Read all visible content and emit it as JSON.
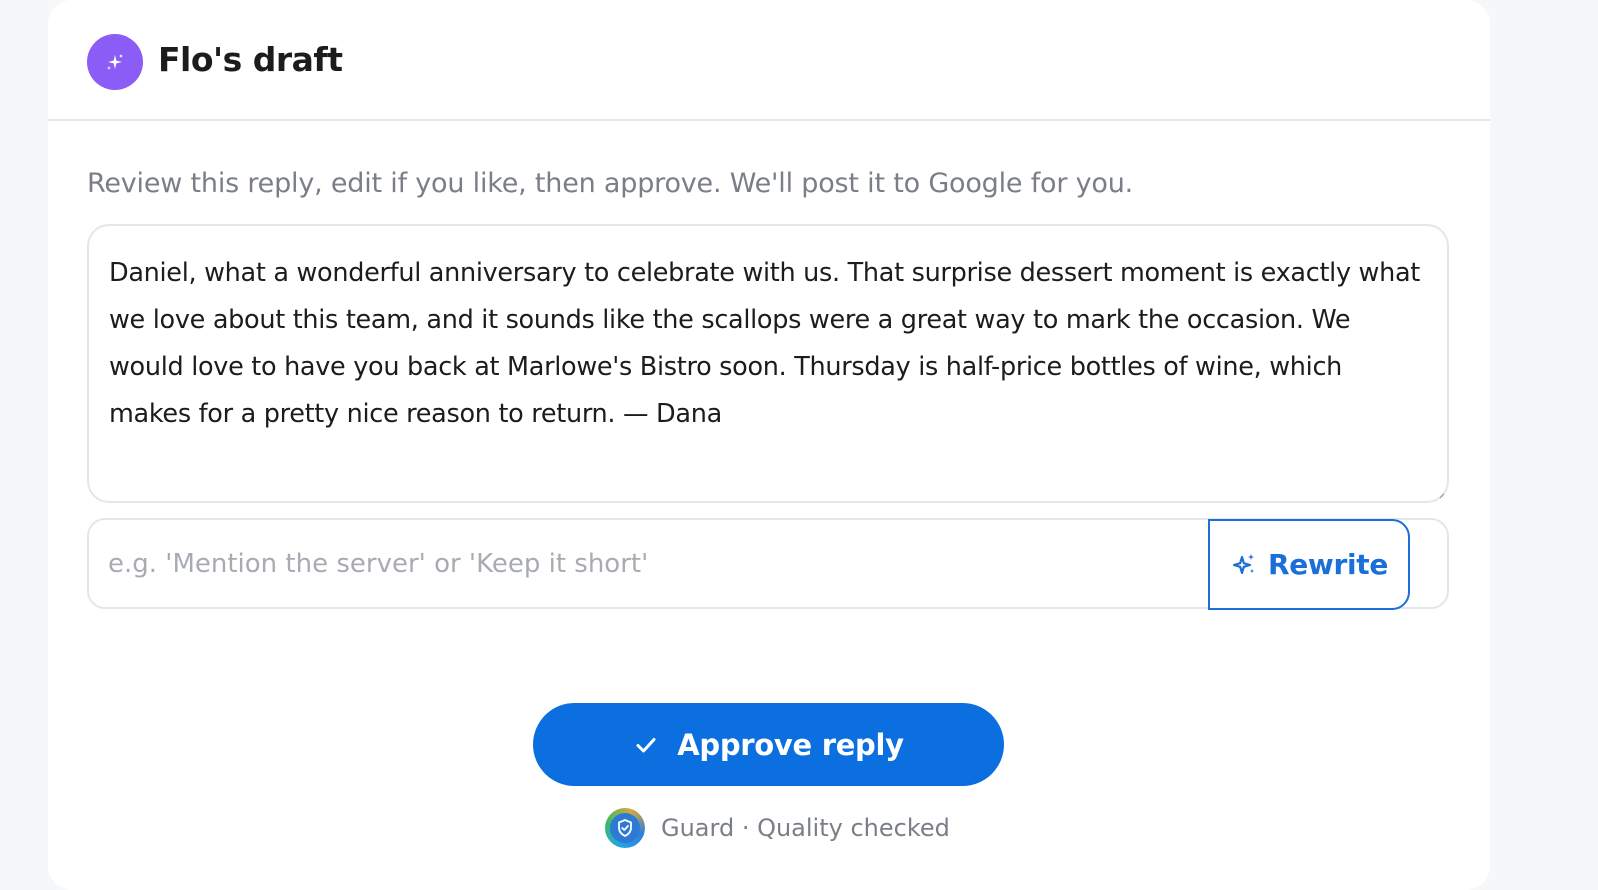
{
  "header": {
    "title": "Flo's draft",
    "avatar_icon": "sparkle-icon",
    "avatar_color": "#8b5cf6"
  },
  "instructions": "Review this reply, edit if you like, then approve. We'll post it to Google for you.",
  "reply": {
    "text": "Daniel, what a wonderful anniversary to celebrate with us. That surprise dessert moment is exactly what we love about this team, and it sounds like the scallops were a great way to mark the occasion. We would love to have you back at Marlowe's Bistro soon. Thursday is half-price bottles of wine, which makes for a pretty nice reason to return. — Dana"
  },
  "rewrite": {
    "placeholder": "e.g. 'Mention the server' or 'Keep it short'",
    "value": "",
    "button_label": "Rewrite",
    "button_icon": "sparkle-icon",
    "accent_color": "#1a6fd8"
  },
  "approve": {
    "label": "Approve reply",
    "icon": "check-icon",
    "color": "#0b6fe0"
  },
  "guard": {
    "icon": "shield-check-icon",
    "text": "Guard · Quality checked"
  }
}
